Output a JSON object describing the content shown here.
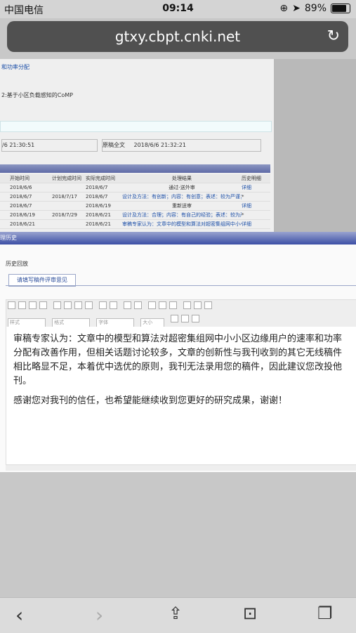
{
  "status_bar": {
    "carrier": "中国电信",
    "time": "09:14",
    "battery": "89%"
  },
  "browser": {
    "url": "gtxy.cbpt.cnki.net"
  },
  "top_page": {
    "line1": "和功率分配",
    "line2": "2:基于小区负载感知的CoMP",
    "time1": "/6 21:30:51",
    "original_label": "原稿全文",
    "time2": "2018/6/6 21:32:21",
    "table_headers": [
      "开始时间",
      "计划完成时间",
      "实际完成时间",
      "处理结果",
      "历史明细"
    ],
    "rows": [
      [
        "2018/6/6",
        "",
        "2018/6/7",
        "通过-送外审",
        "详细"
      ],
      [
        "2018/6/7",
        "2018/7/17",
        "2018/6/7",
        "设计及方法：有创新；内容：有创意；表述：较为严谨；...",
        "*"
      ],
      [
        "2018/6/7",
        "",
        "2018/6/19",
        "重新送审",
        "详细"
      ],
      [
        "2018/6/19",
        "2018/7/29",
        "2018/6/21",
        "设计及方法：合理；内容：有自己的经验；表述：较为严...",
        "*"
      ],
      [
        "2018/6/21",
        "",
        "2018/6/21",
        "审稿专家认为：文章中的模型和算法对超密集组网中小小...",
        "详细"
      ]
    ]
  },
  "history": {
    "bar_title": "理历史",
    "section_title": "历史回放",
    "tab_label": "请填写稿件评审意见",
    "selects": [
      "样式",
      "格式",
      "字体",
      "大小"
    ],
    "paragraph1": "审稿专家认为：文章中的模型和算法对超密集组网中小小区边缘用户的速率和功率分配有改善作用，但相关话题讨论较多，文章的创新性与我刊收到的其它无线稿件相比略显不足，本着优中选优的原则，我刊无法录用您的稿件，因此建议您改投他刊。",
    "paragraph2": "感谢您对我刊的信任，也希望能继续收到您更好的研究成果，谢谢！"
  }
}
